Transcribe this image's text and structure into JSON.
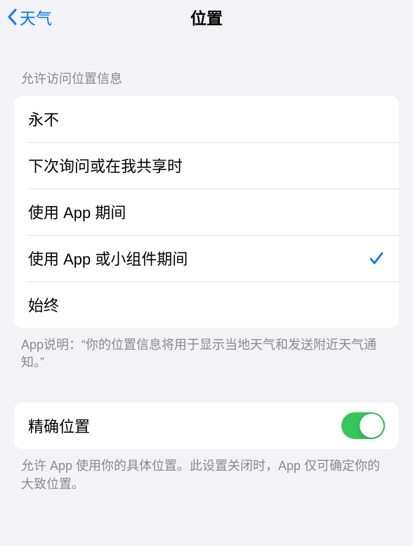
{
  "nav": {
    "back_label": "天气",
    "title": "位置"
  },
  "section1": {
    "header": "允许访问位置信息",
    "options": [
      {
        "label": "永不",
        "selected": false
      },
      {
        "label": "下次询问或在我共享时",
        "selected": false
      },
      {
        "label": "使用 App 期间",
        "selected": false
      },
      {
        "label": "使用 App 或小组件期间",
        "selected": true
      },
      {
        "label": "始终",
        "selected": false
      }
    ],
    "footer": "App说明：“你的位置信息将用于显示当地天气和发送附近天气通知。”"
  },
  "section2": {
    "label": "精确位置",
    "value": true,
    "footer": "允许 App 使用你的具体位置。此设置关闭时，App 仅可确定你的大致位置。"
  }
}
